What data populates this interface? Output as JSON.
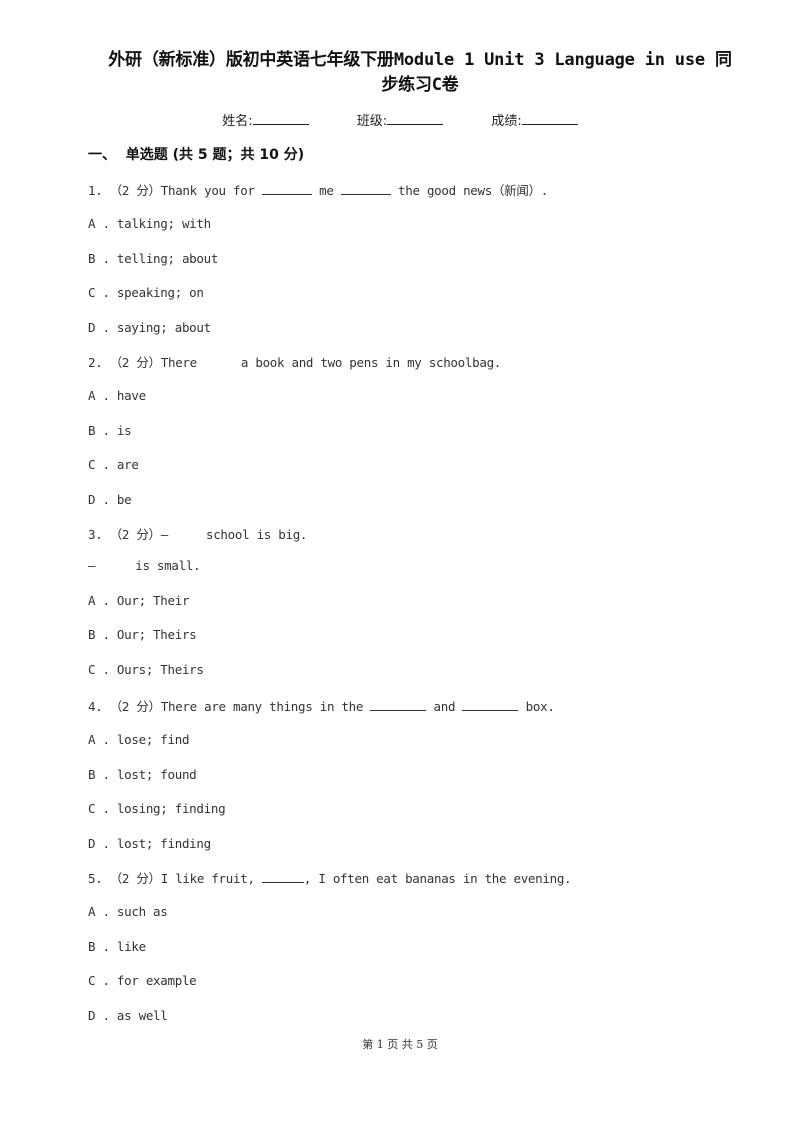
{
  "document": {
    "title_line1": "外研（新标准）版初中英语七年级下册Module 1 Unit 3 Language in use 同",
    "title_line2": "步练习C卷",
    "info": {
      "name_label": "姓名:",
      "class_label": "班级:",
      "score_label": "成绩:"
    },
    "section": {
      "heading": "一、  单选题 (共 5 题；共 10 分)"
    },
    "questions": [
      {
        "number": "1.",
        "points": "（2 分）",
        "stem_parts": [
          "Thank you for ",
          " me ",
          " the good news（新闻）."
        ],
        "options": [
          {
            "letter": "A .",
            "text": "talking; with"
          },
          {
            "letter": "B .",
            "text": "telling; about"
          },
          {
            "letter": "C .",
            "text": "speaking; on"
          },
          {
            "letter": "D .",
            "text": "saying; about"
          }
        ]
      },
      {
        "number": "2.",
        "points": "（2 分）",
        "stem_parts": [
          "There",
          "a book and two pens in my schoolbag."
        ],
        "options": [
          {
            "letter": "A .",
            "text": "have"
          },
          {
            "letter": "B .",
            "text": "is"
          },
          {
            "letter": "C .",
            "text": "are"
          },
          {
            "letter": "D .",
            "text": "be"
          }
        ]
      },
      {
        "number": "3.",
        "points": "（2 分）",
        "stem_parts": [
          "—",
          "school is big."
        ],
        "stem_line2_parts": [
          "—",
          "is small."
        ],
        "options": [
          {
            "letter": "A .",
            "text": "Our; Their"
          },
          {
            "letter": "B .",
            "text": "Our; Theirs"
          },
          {
            "letter": "C .",
            "text": "Ours; Theirs"
          }
        ]
      },
      {
        "number": "4.",
        "points": "（2 分）",
        "stem_parts": [
          "There are many things in the ",
          " and ",
          " box."
        ],
        "options": [
          {
            "letter": "A .",
            "text": "lose; find"
          },
          {
            "letter": "B .",
            "text": "lost; found"
          },
          {
            "letter": "C .",
            "text": "losing; finding"
          },
          {
            "letter": "D .",
            "text": "lost; finding"
          }
        ]
      },
      {
        "number": "5.",
        "points": "（2 分）",
        "stem_parts": [
          "I like fruit, ",
          ", I often eat bananas in the evening."
        ],
        "options": [
          {
            "letter": "A .",
            "text": "such as"
          },
          {
            "letter": "B .",
            "text": "like"
          },
          {
            "letter": "C .",
            "text": "for example"
          },
          {
            "letter": "D .",
            "text": "as well"
          }
        ]
      }
    ],
    "footer": "第 1 页 共 5 页"
  }
}
